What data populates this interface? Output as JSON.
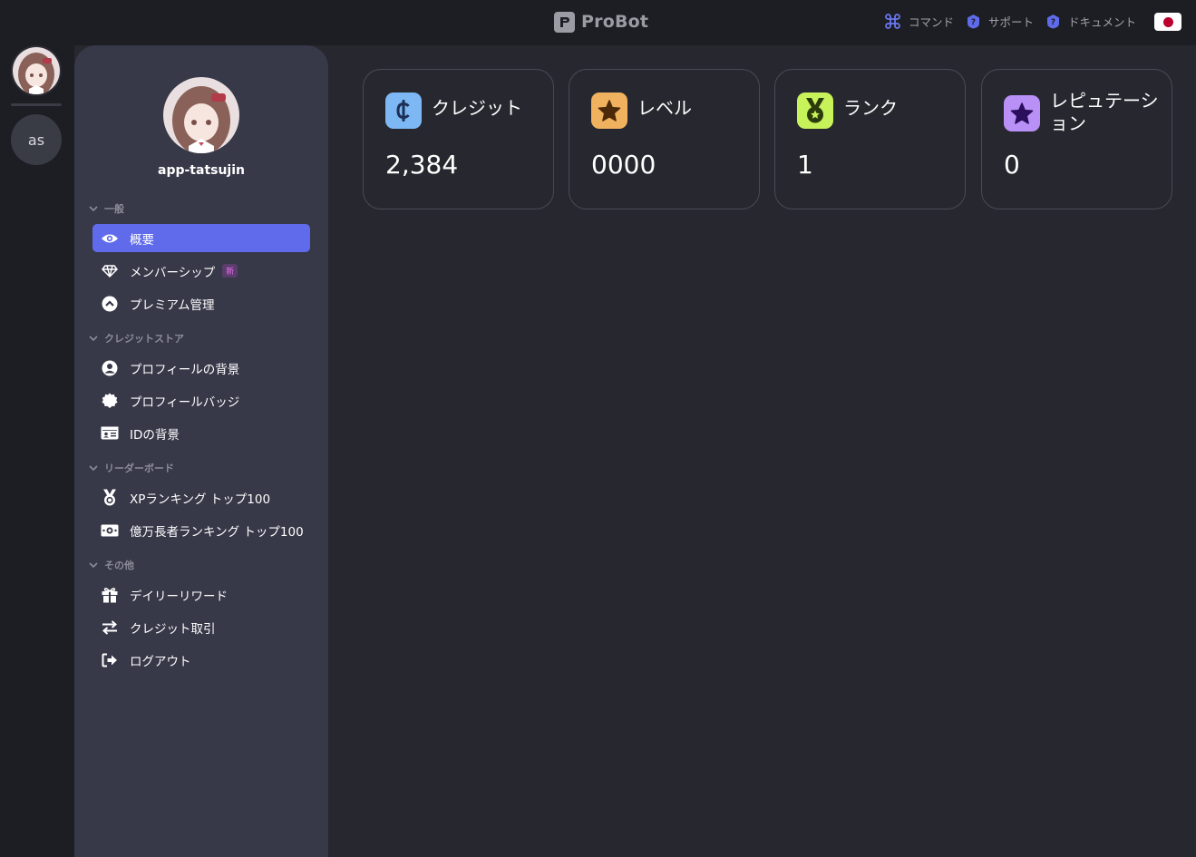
{
  "app": {
    "brand": "ProBot",
    "accent": "#5f6bea"
  },
  "topbar": {
    "links": [
      {
        "label": "コマンド",
        "icon": "command-icon"
      },
      {
        "label": "サポート",
        "icon": "help-icon"
      },
      {
        "label": "ドキュメント",
        "icon": "help-icon"
      }
    ],
    "language_flag": "japan-flag-icon"
  },
  "rail": {
    "guild_label": "as"
  },
  "profile": {
    "username": "app-tatsujin"
  },
  "sidebar": {
    "sections": [
      {
        "title": "一般",
        "items": [
          {
            "label": "概要",
            "icon": "eye-icon",
            "active": true
          },
          {
            "label": "メンバーシップ",
            "icon": "diamond-icon",
            "badge": "新"
          },
          {
            "label": "プレミアム管理",
            "icon": "chevron-up-circle-icon"
          }
        ]
      },
      {
        "title": "クレジットストア",
        "items": [
          {
            "label": "プロフィールの背景",
            "icon": "user-circle-icon"
          },
          {
            "label": "プロフィールバッジ",
            "icon": "certificate-icon"
          },
          {
            "label": "IDの背景",
            "icon": "id-card-icon"
          }
        ]
      },
      {
        "title": "リーダーボード",
        "items": [
          {
            "label": "XPランキング トップ100",
            "icon": "medal-icon"
          },
          {
            "label": "億万長者ランキング トップ100",
            "icon": "money-bill-icon"
          }
        ]
      },
      {
        "title": "その他",
        "items": [
          {
            "label": "デイリーリワード",
            "icon": "gift-icon"
          },
          {
            "label": "クレジット取引",
            "icon": "transfer-icon"
          },
          {
            "label": "ログアウト",
            "icon": "logout-icon"
          }
        ]
      }
    ]
  },
  "stats": [
    {
      "title": "クレジット",
      "value": "2,384",
      "icon": "cent-icon",
      "color": "#7db8f5"
    },
    {
      "title": "レベル",
      "value": "0000",
      "icon": "star-icon",
      "color": "#f1b25f"
    },
    {
      "title": "ランク",
      "value": "1",
      "icon": "medal-icon",
      "color": "#c8f25a"
    },
    {
      "title": "レピュテーション",
      "value": "0",
      "icon": "star-icon",
      "color": "#b990f5"
    }
  ]
}
